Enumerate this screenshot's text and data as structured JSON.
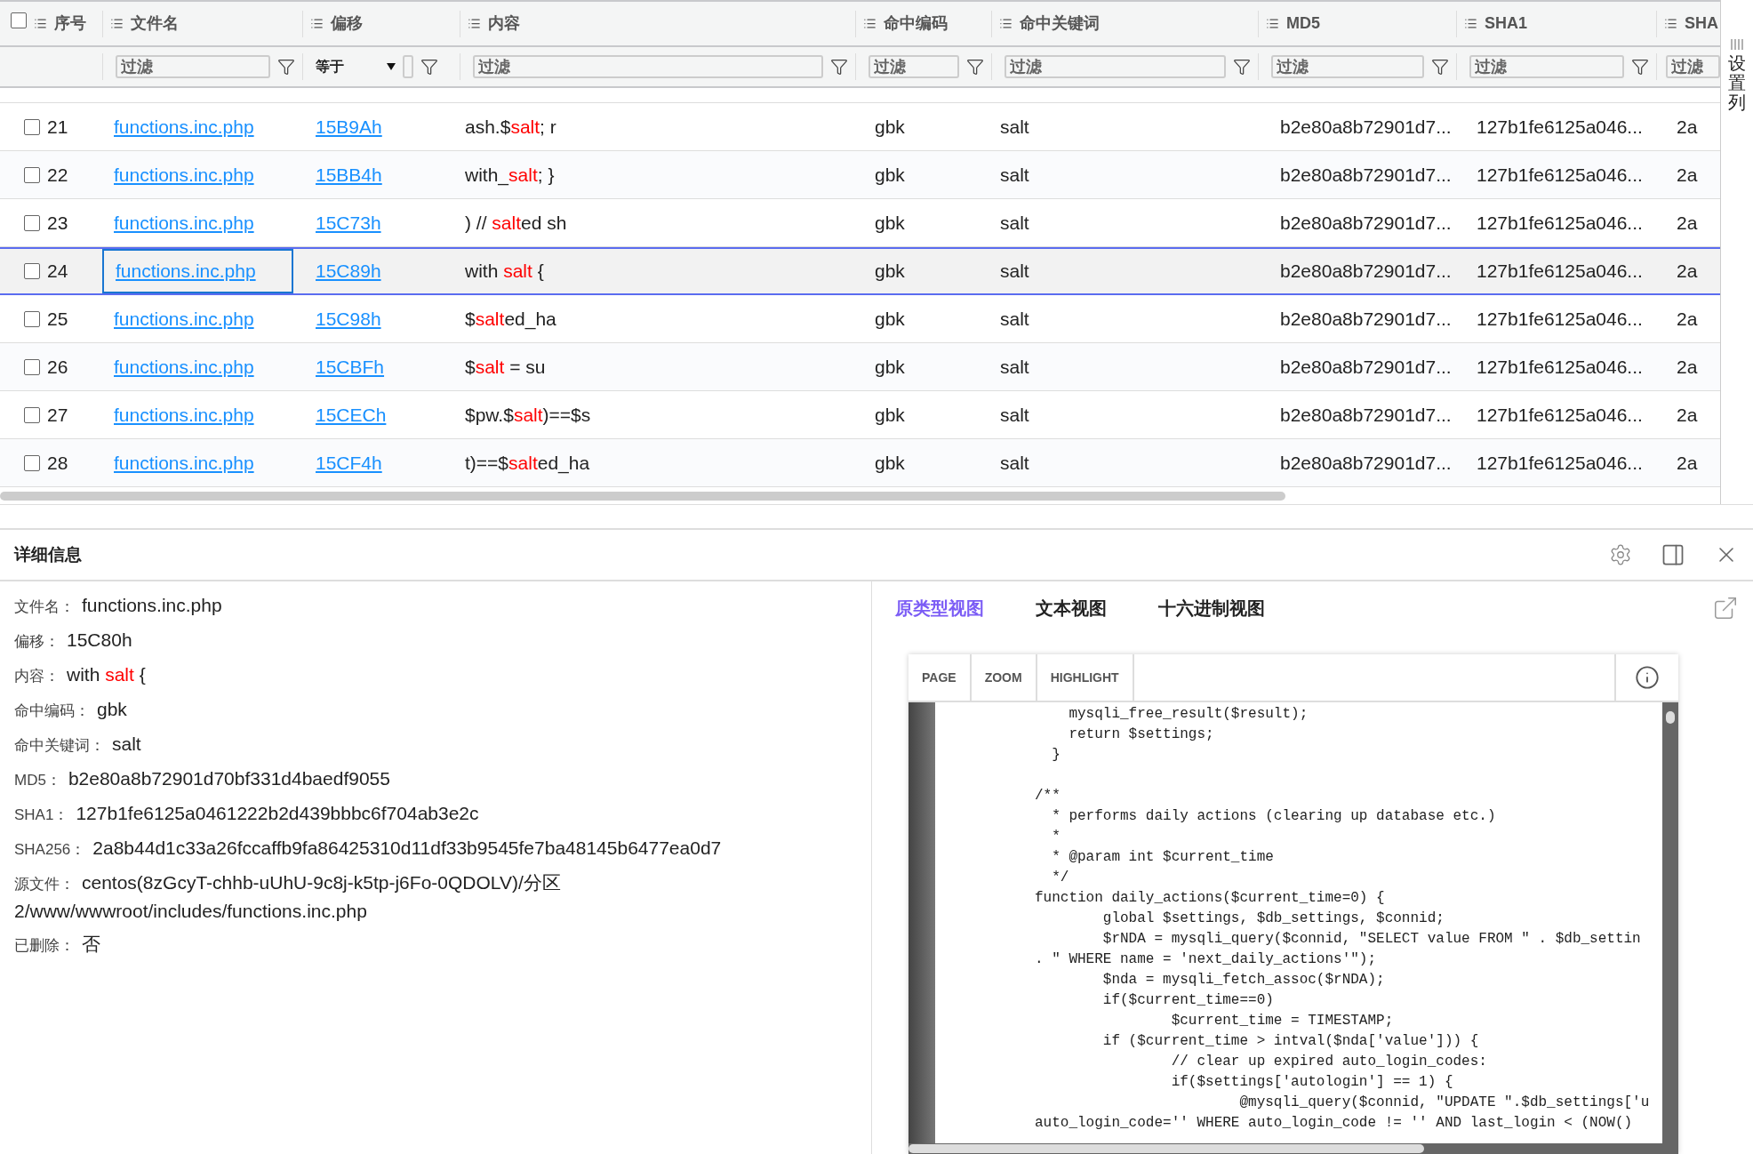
{
  "table": {
    "select_all_checked": false,
    "columns": [
      {
        "label": "序号",
        "kind": "plain"
      },
      {
        "label": "文件名",
        "kind": "text",
        "placeholder": "过滤"
      },
      {
        "label": "偏移",
        "kind": "select",
        "value": "等于"
      },
      {
        "label": "内容",
        "kind": "text",
        "placeholder": "过滤"
      },
      {
        "label": "命中编码",
        "kind": "text",
        "placeholder": "过滤"
      },
      {
        "label": "命中关键词",
        "kind": "text",
        "placeholder": "过滤"
      },
      {
        "label": "MD5",
        "kind": "text",
        "placeholder": "过滤"
      },
      {
        "label": "SHA1",
        "kind": "text",
        "placeholder": "过滤"
      },
      {
        "label": "SHA",
        "kind": "text",
        "placeholder": "过滤"
      }
    ],
    "rows": [
      {
        "index": "21",
        "checked": false,
        "selected": false,
        "focused": false,
        "file": "functions.inc.php",
        "offset": "15B9Ah",
        "content": {
          "before": "ash.$",
          "keyword": "salt",
          "after": "; r"
        },
        "encoding": "gbk",
        "keyword": "salt",
        "md5": "b2e80a8b72901d7...",
        "sha1": "127b1fe6125a046...",
        "sha": "2a"
      },
      {
        "index": "22",
        "checked": false,
        "selected": false,
        "focused": false,
        "file": "functions.inc.php",
        "offset": "15BB4h",
        "content": {
          "before": "with_",
          "keyword": "salt",
          "after": "; }"
        },
        "encoding": "gbk",
        "keyword": "salt",
        "md5": "b2e80a8b72901d7...",
        "sha1": "127b1fe6125a046...",
        "sha": "2a"
      },
      {
        "index": "23",
        "checked": false,
        "selected": false,
        "focused": false,
        "file": "functions.inc.php",
        "offset": "15C73h",
        "content": {
          "before": ") // ",
          "keyword": "salt",
          "after": "ed sh"
        },
        "encoding": "gbk",
        "keyword": "salt",
        "md5": "b2e80a8b72901d7...",
        "sha1": "127b1fe6125a046...",
        "sha": "2a"
      },
      {
        "index": "24",
        "checked": false,
        "selected": true,
        "focused": true,
        "file": "functions.inc.php",
        "offset": "15C89h",
        "content": {
          "before": "with ",
          "keyword": "salt",
          "after": " {"
        },
        "encoding": "gbk",
        "keyword": "salt",
        "md5": "b2e80a8b72901d7...",
        "sha1": "127b1fe6125a046...",
        "sha": "2a"
      },
      {
        "index": "25",
        "checked": false,
        "selected": false,
        "focused": false,
        "file": "functions.inc.php",
        "offset": "15C98h",
        "content": {
          "before": "$",
          "keyword": "salt",
          "after": "ed_ha"
        },
        "encoding": "gbk",
        "keyword": "salt",
        "md5": "b2e80a8b72901d7...",
        "sha1": "127b1fe6125a046...",
        "sha": "2a"
      },
      {
        "index": "26",
        "checked": false,
        "selected": false,
        "focused": false,
        "file": "functions.inc.php",
        "offset": "15CBFh",
        "content": {
          "before": "$",
          "keyword": "salt",
          "after": " = su"
        },
        "encoding": "gbk",
        "keyword": "salt",
        "md5": "b2e80a8b72901d7...",
        "sha1": "127b1fe6125a046...",
        "sha": "2a"
      },
      {
        "index": "27",
        "checked": false,
        "selected": false,
        "focused": false,
        "file": "functions.inc.php",
        "offset": "15CECh",
        "content": {
          "before": "$pw.$",
          "keyword": "salt",
          "after": ")==$s"
        },
        "encoding": "gbk",
        "keyword": "salt",
        "md5": "b2e80a8b72901d7...",
        "sha1": "127b1fe6125a046...",
        "sha": "2a"
      },
      {
        "index": "28",
        "checked": false,
        "selected": false,
        "focused": false,
        "file": "functions.inc.php",
        "offset": "15CF4h",
        "content": {
          "before": "t)==$",
          "keyword": "salt",
          "after": "ed_ha"
        },
        "encoding": "gbk",
        "keyword": "salt",
        "md5": "b2e80a8b72901d7...",
        "sha1": "127b1fe6125a046...",
        "sha": "2a"
      }
    ]
  },
  "settings_column": {
    "label": "设置列"
  },
  "details": {
    "title": "详细信息",
    "fields": [
      {
        "kind": "text",
        "label": "文件名：",
        "value": "functions.inc.php"
      },
      {
        "kind": "text",
        "label": "偏移：",
        "value": "15C80h"
      },
      {
        "kind": "highlight",
        "label": "内容：",
        "before": "with ",
        "keyword": "salt",
        "after": " {"
      },
      {
        "kind": "text",
        "label": "命中编码：",
        "value": "gbk"
      },
      {
        "kind": "text",
        "label": "命中关键词：",
        "value": "salt"
      },
      {
        "kind": "text",
        "label": "MD5：",
        "value": "b2e80a8b72901d70bf331d4baedf9055"
      },
      {
        "kind": "text",
        "label": "SHA1：",
        "value": "127b1fe6125a0461222b2d439bbbc6f704ab3e2c"
      },
      {
        "kind": "text",
        "label": "SHA256：",
        "value": "2a8b44d1c33a26fccaffb9fa86425310d11df33b9545fe7ba48145b6477ea0d7"
      },
      {
        "kind": "text",
        "label": "源文件：",
        "value": "centos(8zGcyT-chhb-uUhU-9c8j-k5tp-j6Fo-0QDOLV)/分区 2/www/wwwroot/includes/functions.inc.php"
      },
      {
        "kind": "text",
        "label": "已删除：",
        "value": "否"
      }
    ],
    "viewer": {
      "tabs": [
        {
          "label": "原类型视图",
          "selected": true
        },
        {
          "label": "文本视图",
          "selected": false
        },
        {
          "label": "十六进制视图",
          "selected": false
        }
      ],
      "toolbar": [
        "PAGE",
        "ZOOM",
        "HIGHLIGHT"
      ],
      "code_lines": [
        {
          "kind": "code",
          "text": "    mysqli_free_result($result);"
        },
        {
          "kind": "code",
          "text": "    return $settings;"
        },
        {
          "kind": "code",
          "text": "  }"
        },
        {
          "kind": "blank"
        },
        {
          "kind": "code",
          "text": "/**"
        },
        {
          "kind": "code",
          "text": "  * performs daily actions (clearing up database etc.)"
        },
        {
          "kind": "code",
          "text": "  *"
        },
        {
          "kind": "code",
          "text": "  * @param int $current_time"
        },
        {
          "kind": "code",
          "text": "  */"
        },
        {
          "kind": "code",
          "text": "function daily_actions($current_time=0) {"
        },
        {
          "kind": "code",
          "text": "        global $settings, $db_settings, $connid;"
        },
        {
          "kind": "code",
          "text": "        $rNDA = mysqli_query($connid, \"SELECT value FROM \" . $db_settin"
        },
        {
          "kind": "code",
          "text": ". \" WHERE name = 'next_daily_actions'\");"
        },
        {
          "kind": "code",
          "text": "        $nda = mysqli_fetch_assoc($rNDA);"
        },
        {
          "kind": "code",
          "text": "        if($current_time==0)"
        },
        {
          "kind": "code",
          "text": "                $current_time = TIMESTAMP;"
        },
        {
          "kind": "code",
          "text": "        if ($current_time > intval($nda['value'])) {"
        },
        {
          "kind": "code",
          "text": "                // clear up expired auto_login_codes:"
        },
        {
          "kind": "code",
          "text": "                if($settings['autologin'] == 1) {"
        },
        {
          "kind": "code",
          "text": "                        @mysqli_query($connid, \"UPDATE \".$db_settings['u"
        },
        {
          "kind": "code",
          "text": "auto_login_code='' WHERE auto_login_code != '' AND last_login < (NOW()"
        }
      ]
    }
  }
}
